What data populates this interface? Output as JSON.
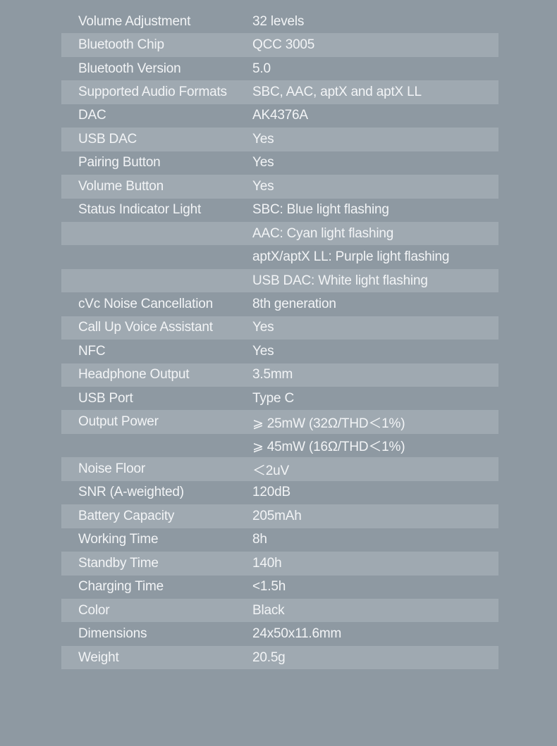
{
  "specs": [
    {
      "label": "Volume Adjustment",
      "value": "32 levels"
    },
    {
      "label": "Bluetooth Chip",
      "value": "QCC 3005"
    },
    {
      "label": "Bluetooth Version",
      "value": "5.0"
    },
    {
      "label": "Supported Audio Formats",
      "value": "SBC, AAC, aptX and aptX LL"
    },
    {
      "label": "DAC",
      "value": "AK4376A"
    },
    {
      "label": "USB DAC",
      "value": "Yes"
    },
    {
      "label": "Pairing Button",
      "value": "Yes"
    },
    {
      "label": "Volume Button",
      "value": "Yes"
    },
    {
      "label": "Status Indicator Light",
      "value": "SBC: Blue light flashing"
    },
    {
      "label": "",
      "value": "AAC: Cyan light flashing"
    },
    {
      "label": "",
      "value": "aptX/aptX LL: Purple light flashing"
    },
    {
      "label": "",
      "value": "USB DAC: White light flashing"
    },
    {
      "label": "cVc Noise Cancellation",
      "value": "8th generation"
    },
    {
      "label": "Call Up Voice Assistant",
      "value": "Yes"
    },
    {
      "label": "NFC",
      "value": "Yes"
    },
    {
      "label": "Headphone Output",
      "value": "3.5mm"
    },
    {
      "label": "USB Port",
      "value": "Type C"
    },
    {
      "label": "Output Power",
      "value": "⩾ 25mW (32Ω/THD＜1%)"
    },
    {
      "label": "",
      "value": "⩾ 45mW (16Ω/THD＜1%)"
    },
    {
      "label": "Noise Floor",
      "value": "＜2uV"
    },
    {
      "label": "SNR (A-weighted)",
      "value": "120dB"
    },
    {
      "label": "Battery Capacity",
      "value": "205mAh"
    },
    {
      "label": "Working Time",
      "value": "8h"
    },
    {
      "label": "Standby Time",
      "value": "140h"
    },
    {
      "label": "Charging Time",
      "value": "<1.5h"
    },
    {
      "label": "Color",
      "value": "Black"
    },
    {
      "label": "Dimensions",
      "value": "24x50x11.6mm"
    },
    {
      "label": "Weight",
      "value": "20.5g"
    }
  ],
  "colors": {
    "background": "#8e99a2",
    "stripe": "#9fa9b1",
    "text": "#f2f4f6"
  }
}
